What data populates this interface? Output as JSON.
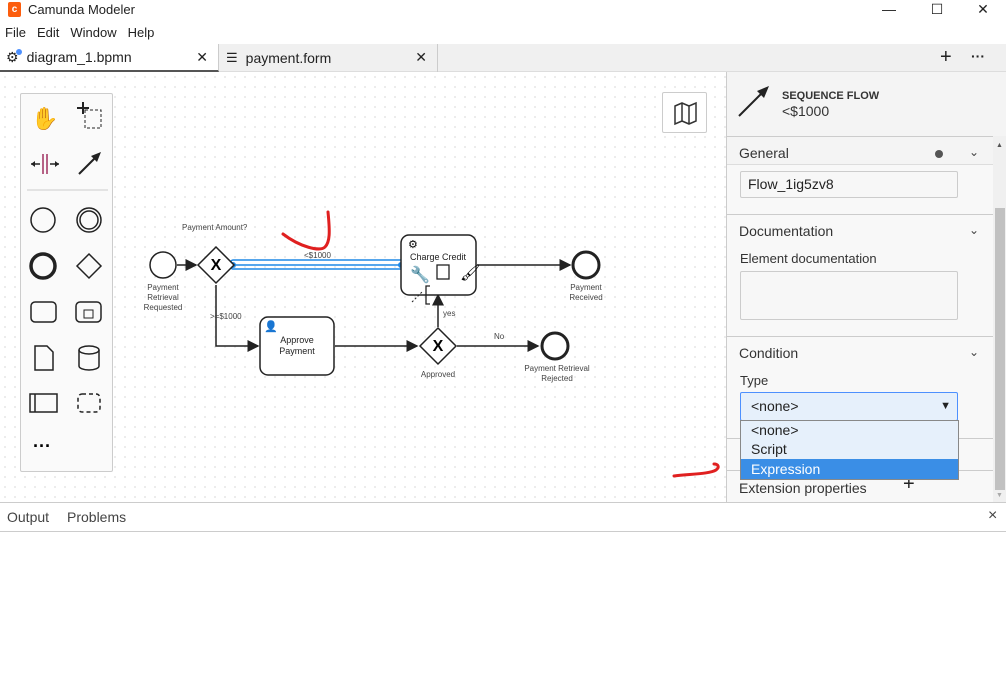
{
  "window": {
    "title": "Camunda Modeler",
    "minimize": "—",
    "maximize": "☐",
    "close": "✕"
  },
  "menu": [
    "File",
    "Edit",
    "Window",
    "Help"
  ],
  "tabs": [
    {
      "label": "diagram_1.bpmn",
      "active": true,
      "unsaved": true,
      "icon": "gear-icon"
    },
    {
      "label": "payment.form",
      "active": false,
      "icon": "form-icon"
    }
  ],
  "tabbar_actions": {
    "add": "+",
    "more": "···"
  },
  "diagram": {
    "start_event": "Payment Retrieval Requested",
    "gateway1": "Payment Amount?",
    "flow_selected": "<$1000",
    "flow_ge": ">=$1000",
    "task_charge": "Charge Credit",
    "task_approve": "Approve Payment",
    "gateway2": "Approved",
    "flow_yes": "yes",
    "flow_no": "No",
    "end_received": "Payment Received",
    "end_rejected": "Payment Retrieval Rejected"
  },
  "properties": {
    "header_type": "SEQUENCE FLOW",
    "header_name": "<$1000",
    "general": {
      "title": "General",
      "id_value": "Flow_1ig5zv8"
    },
    "documentation": {
      "title": "Documentation",
      "label": "Element documentation",
      "value": ""
    },
    "condition": {
      "title": "Condition",
      "type_label": "Type",
      "selected": "<none>",
      "options": [
        "<none>",
        "Script",
        "Expression"
      ],
      "highlighted": "Expression"
    },
    "extension": {
      "title": "Extension properties",
      "add": "+"
    }
  },
  "bottom": {
    "output": "Output",
    "problems": "Problems",
    "close": "×"
  },
  "colors": {
    "accent": "#4d90fe",
    "select": "#1e88e5",
    "highlight": "#3a8ee6",
    "annotation": "#e02020"
  }
}
